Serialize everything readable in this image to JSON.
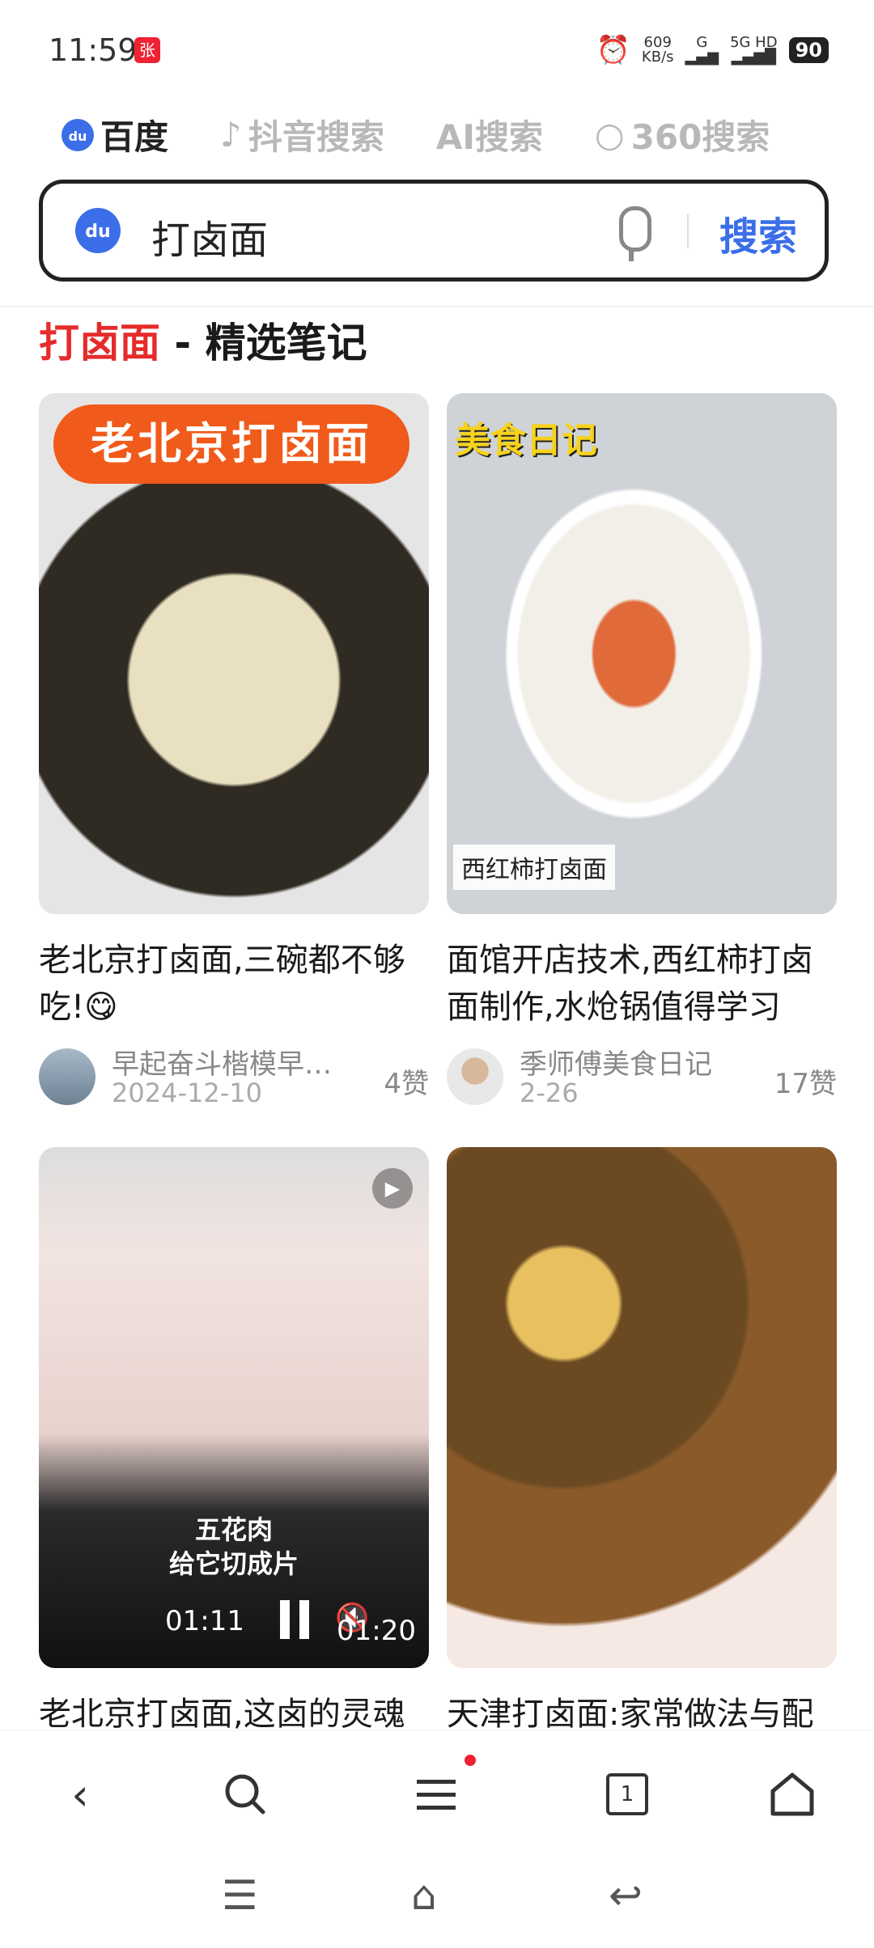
{
  "status_bar": {
    "time": "11:59",
    "net_speed_top": "609",
    "net_speed_unit": "KB/s",
    "sig1": "G",
    "sig2": "5G HD",
    "battery": "90"
  },
  "engines": [
    {
      "label": "百度",
      "active": true
    },
    {
      "label": "抖音搜索",
      "active": false
    },
    {
      "label": "AI搜索",
      "active": false
    },
    {
      "label": "360搜索",
      "active": false
    }
  ],
  "search": {
    "query": "打卤面",
    "button_label": "搜索"
  },
  "section": {
    "title_red": "打卤面",
    "title_rest": " - 精选笔记"
  },
  "cards": [
    {
      "badge": "老北京打卤面",
      "caption": "老北京打卤面,三碗都不够吃!😋",
      "author": "早起奋斗楷模早…",
      "date": "2024-12-10",
      "likes": "4赞"
    },
    {
      "badge": "美食日记",
      "label": "西红柿打卤面",
      "caption": "面馆开店技术,西红柿打卤面制作,水炝锅值得学习",
      "author": "季师傅美食日记",
      "date": "2-26",
      "likes": "17赞"
    },
    {
      "overlay_line1": "五花肉",
      "overlay_line2": "给它切成片",
      "time_current": "01:11",
      "time_total": "01:20",
      "caption": "老北京打卤面,这卤的灵魂"
    },
    {
      "caption": "天津打卤面:家常做法与配"
    }
  ],
  "bottom_nav": {
    "tab_count": "1"
  }
}
